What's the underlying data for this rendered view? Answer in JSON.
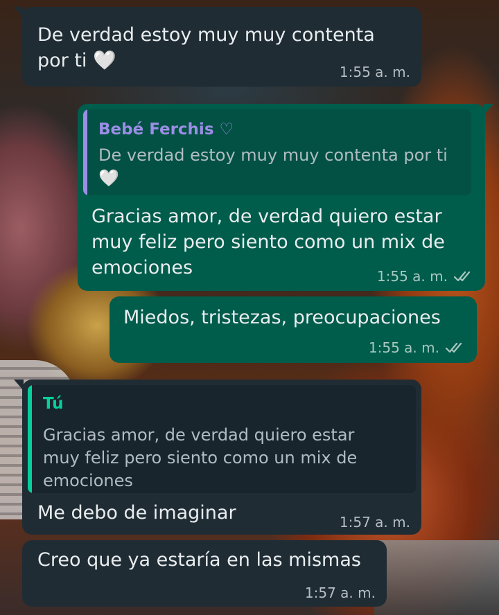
{
  "messages": [
    {
      "direction": "incoming",
      "text": "De verdad estoy muy muy contenta por ti 🤍",
      "time": "1:55 a. m.",
      "emoji_icon": "white-heart-icon"
    },
    {
      "direction": "outgoing",
      "reply_to": {
        "name": "Bebé Ferchis ♡",
        "name_color": "#9b8ee6",
        "text": "De verdad estoy muy muy contenta por ti 🤍"
      },
      "text": "Gracias amor, de verdad quiero estar muy feliz pero siento como un mix de emociones",
      "time": "1:55 a. m.",
      "status": "read"
    },
    {
      "direction": "outgoing",
      "text": "Miedos, tristezas, preocupaciones",
      "time": "1:55 a. m.",
      "status": "read"
    },
    {
      "direction": "incoming",
      "reply_to": {
        "name": "Tú",
        "name_color": "#06cf9c",
        "text": "Gracias amor, de verdad quiero estar muy feliz pero siento como un mix de emociones"
      },
      "text": "Me debo de imaginar",
      "time": "1:57 a. m."
    },
    {
      "direction": "incoming",
      "text": "Creo que ya estaría en las mismas",
      "time": "1:57 a. m."
    }
  ],
  "colors": {
    "incoming_bubble": "#1f2c34",
    "outgoing_bubble": "#005c4b",
    "quote_incoming_bg": "#18252c",
    "quote_outgoing_bg": "#025144",
    "read_ticks": "#a8c9c1"
  }
}
